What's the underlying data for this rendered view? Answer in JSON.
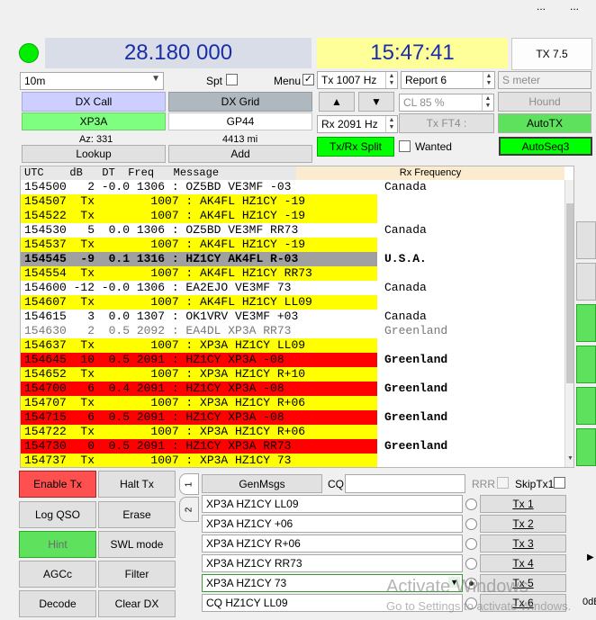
{
  "colors": {
    "tx_row": "#ffff00",
    "highlight_row": "#ff0000",
    "gray_row": "#a0a0a0",
    "green": "#00ff00",
    "freq_bg": "#d8dde8",
    "time_bg": "#ffff99",
    "dxcall_bg": "#cccfff",
    "dxgrid_bg": "#b0b8bf",
    "call_green": "#7fff7f"
  },
  "top": {
    "dial_frequency": "28.180 000",
    "utc_time": "15:47:41",
    "tx_button": "TX 7.5",
    "topright_dots": "..."
  },
  "controls": {
    "band": "10m",
    "spt_label": "Spt",
    "menu_label": "Menu",
    "menu_checked": "✓",
    "tx_freq": "Tx  1007  Hz",
    "report": "Report 6",
    "smeter": "S meter",
    "dx_call_label": "DX Call",
    "dx_grid_label": "DX Grid",
    "up_arrow": "▲",
    "down_arrow": "▼",
    "cl_percent": "CL  85 %",
    "hound": "Hound",
    "dx_call_value": "XP3A",
    "dx_grid_value": "GP44",
    "rx_freq": "Rx  2091  Hz",
    "tx_ft4": "Tx FT4 :",
    "autotx": "AutoTX",
    "azimuth": "Az: 331",
    "distance": "4413 mi",
    "txrx_split": "Tx/Rx Split",
    "wanted": "Wanted",
    "autoseq": "AutoSeq3",
    "lookup": "Lookup",
    "add": "Add"
  },
  "activity": {
    "header": "UTC    dB   DT  Freq   Message",
    "rx_header": "Rx Frequency",
    "rows": [
      {
        "text": "154500   2 -0.0 1306 : OZ5BD VE3MF -03",
        "country": "Canada",
        "style": "plain"
      },
      {
        "text": "154507  Tx        1007 : AK4FL HZ1CY -19",
        "country": "",
        "style": "tx"
      },
      {
        "text": "154522  Tx        1007 : AK4FL HZ1CY -19",
        "country": "",
        "style": "tx"
      },
      {
        "text": "154530   5  0.0 1306 : OZ5BD VE3MF RR73",
        "country": "Canada",
        "style": "plain"
      },
      {
        "text": "154537  Tx        1007 : AK4FL HZ1CY -19",
        "country": "",
        "style": "tx"
      },
      {
        "text": "154545  -9  0.1 1316 : HZ1CY AK4FL R-03",
        "country": "U.S.A.",
        "style": "gray"
      },
      {
        "text": "154554  Tx        1007 : AK4FL HZ1CY RR73",
        "country": "",
        "style": "tx"
      },
      {
        "text": "154600 -12 -0.0 1306 : EA2EJO VE3MF 73",
        "country": "Canada",
        "style": "plain"
      },
      {
        "text": "154607  Tx        1007 : AK4FL HZ1CY LL09",
        "country": "",
        "style": "tx"
      },
      {
        "text": "154615   3  0.0 1307 : OK1VRV VE3MF +03",
        "country": "Canada",
        "style": "plain"
      },
      {
        "text": "154630   2  0.5 2092 : EA4DL XP3A RR73",
        "country": "Greenland",
        "style": "dim"
      },
      {
        "text": "154637  Tx        1007 : XP3A HZ1CY LL09",
        "country": "",
        "style": "tx"
      },
      {
        "text": "154645  10  0.5 2091 : HZ1CY XP3A -08",
        "country": "Greenland",
        "style": "red"
      },
      {
        "text": "154652  Tx        1007 : XP3A HZ1CY R+10",
        "country": "",
        "style": "tx"
      },
      {
        "text": "154700   6  0.4 2091 : HZ1CY XP3A -08",
        "country": "Greenland",
        "style": "red"
      },
      {
        "text": "154707  Tx        1007 : XP3A HZ1CY R+06",
        "country": "",
        "style": "tx"
      },
      {
        "text": "154715   6  0.5 2091 : HZ1CY XP3A -08",
        "country": "Greenland",
        "style": "red"
      },
      {
        "text": "154722  Tx        1007 : XP3A HZ1CY R+06",
        "country": "",
        "style": "tx"
      },
      {
        "text": "154730   0  0.5 2091 : HZ1CY XP3A RR73",
        "country": "Greenland",
        "style": "red"
      },
      {
        "text": "154737  Tx        1007 : XP3A HZ1CY 73",
        "country": "",
        "style": "tx"
      }
    ]
  },
  "buttons": {
    "enable_tx": "Enable Tx",
    "halt_tx": "Halt Tx",
    "log_qso": "Log QSO",
    "erase": "Erase",
    "hint": "Hint",
    "swl_mode": "SWL mode",
    "agcc": "AGCc",
    "filter": "Filter",
    "decode": "Decode",
    "clear_dx": "Clear DX"
  },
  "messages": {
    "tab1": "1",
    "tab2": "2",
    "genmsgs": "GenMsgs",
    "cq_label": "CQ",
    "rrr_label": "RRR",
    "skiptx1_label": "SkipTx1",
    "tx_messages": [
      {
        "msg": "XP3A HZ1CY LL09",
        "label": "Tx 1"
      },
      {
        "msg": "XP3A HZ1CY +06",
        "label": "Tx 2"
      },
      {
        "msg": "XP3A HZ1CY R+06",
        "label": "Tx 3"
      },
      {
        "msg": "XP3A HZ1CY RR73",
        "label": "Tx 4"
      },
      {
        "msg": "XP3A HZ1CY 73",
        "label": "Tx 5"
      },
      {
        "msg": "CQ HZ1CY LL09",
        "label": "Tx 6"
      }
    ],
    "watermark_line1": "Activate Windows",
    "watermark_line2": "Go to Settings to activate Windows.",
    "right_edge_text": "0dB"
  }
}
